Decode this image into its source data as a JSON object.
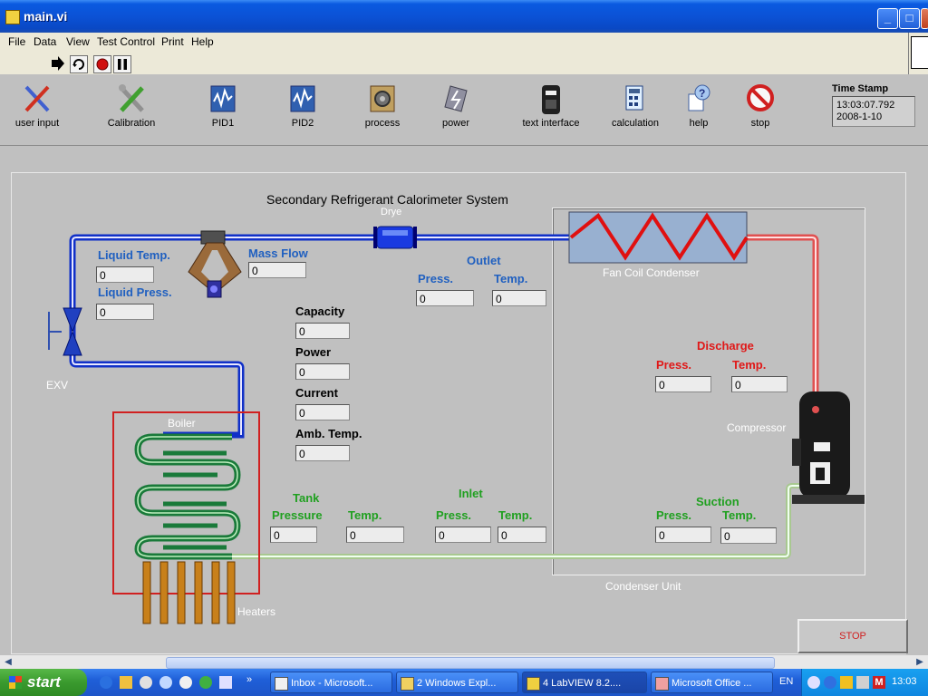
{
  "window": {
    "title": "main.vi"
  },
  "menu": [
    "File",
    "Data",
    "View",
    "Test Control",
    "Print",
    "Help"
  ],
  "toolbar_icons": [
    "run-arrow-icon",
    "run-continuous-icon",
    "abort-icon",
    "pause-icon"
  ],
  "tools": [
    {
      "label": "user input",
      "icon": "user-input-icon"
    },
    {
      "label": "Calibration",
      "icon": "calibration-icon"
    },
    {
      "label": "PID1",
      "icon": "pid1-icon"
    },
    {
      "label": "PID2",
      "icon": "pid2-icon"
    },
    {
      "label": "process",
      "icon": "process-icon"
    },
    {
      "label": "power",
      "icon": "power-icon"
    },
    {
      "label": "text interface",
      "icon": "text-interface-icon"
    },
    {
      "label": "calculation",
      "icon": "calculation-icon"
    },
    {
      "label": "help",
      "icon": "help-icon"
    },
    {
      "label": "stop",
      "icon": "stop-icon"
    }
  ],
  "timestamp": {
    "label": "Time Stamp",
    "time": "13:03:07.792",
    "date": "2008-1-10"
  },
  "diagram": {
    "title": "Secondary Refrigerant Calorimeter System",
    "drye": "Drye",
    "liquid_temp": {
      "label": "Liquid Temp.",
      "value": "0"
    },
    "liquid_press": {
      "label": "Liquid Press.",
      "value": "0"
    },
    "mass_flow": {
      "label": "Mass Flow",
      "value": "0"
    },
    "exv": "EXV",
    "outlet": {
      "label": "Outlet",
      "press_label": "Press.",
      "press": "0",
      "temp_label": "Temp.",
      "temp": "0"
    },
    "fan_coil": "Fan Coil Condenser",
    "capacity": {
      "label": "Capacity",
      "value": "0"
    },
    "power": {
      "label": "Power",
      "value": "0"
    },
    "current": {
      "label": "Current",
      "value": "0"
    },
    "amb_temp": {
      "label": "Amb. Temp.",
      "value": "0"
    },
    "boiler": "Boiler",
    "heaters": "Heaters",
    "tank": {
      "label": "Tank",
      "press_label": "Pressure",
      "press": "0",
      "temp_label": "Temp.",
      "temp": "0"
    },
    "inlet": {
      "label": "Inlet",
      "press_label": "Press.",
      "press": "0",
      "temp_label": "Temp.",
      "temp": "0"
    },
    "discharge": {
      "label": "Discharge",
      "press_label": "Press.",
      "press": "0",
      "temp_label": "Temp.",
      "temp": "0"
    },
    "compressor": "Compressor",
    "suction": {
      "label": "Suction",
      "press_label": "Press.",
      "press": "0",
      "temp_label": "Temp.",
      "temp": "0"
    },
    "condenser_unit": "Condenser Unit"
  },
  "stop_button": "STOP",
  "taskbar": {
    "start": "start",
    "tasks": [
      "Inbox - Microsoft...",
      "2 Windows Expl...",
      "4 LabVIEW 8.2....",
      "Microsoft Office ..."
    ],
    "lang": "EN",
    "clock": "13:03"
  },
  "colors": {
    "liquid_line": "#1030c8",
    "hot_line": "#e04848",
    "suction_line": "#b8dca0",
    "boiler_coil": "#1a7a3a",
    "boiler_box": "#d02020"
  }
}
